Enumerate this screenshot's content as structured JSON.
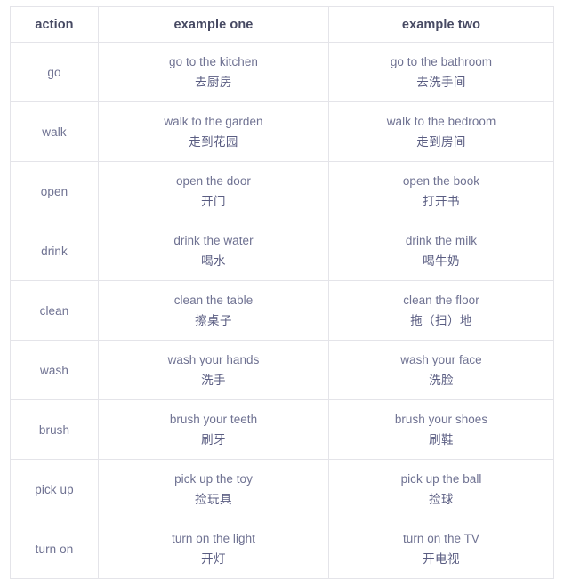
{
  "table": {
    "columns": [
      {
        "key": "action",
        "label": "action"
      },
      {
        "key": "example_one",
        "label": "example one"
      },
      {
        "key": "example_two",
        "label": "example two"
      }
    ],
    "rows": [
      {
        "action": "go",
        "example_one_en": "go to the kitchen",
        "example_one_zh": "去厨房",
        "example_two_en": "go to the bathroom",
        "example_two_zh": "去洗手间"
      },
      {
        "action": "walk",
        "example_one_en": "walk to the garden",
        "example_one_zh": "走到花园",
        "example_two_en": "walk to the bedroom",
        "example_two_zh": "走到房间"
      },
      {
        "action": "open",
        "example_one_en": "open the door",
        "example_one_zh": "开门",
        "example_two_en": "open the book",
        "example_two_zh": "打开书"
      },
      {
        "action": "drink",
        "example_one_en": "drink the water",
        "example_one_zh": "喝水",
        "example_two_en": "drink the milk",
        "example_two_zh": "喝牛奶"
      },
      {
        "action": "clean",
        "example_one_en": "clean the table",
        "example_one_zh": "擦桌子",
        "example_two_en": "clean the floor",
        "example_two_zh": "拖（扫）地"
      },
      {
        "action": "wash",
        "example_one_en": "wash your hands",
        "example_one_zh": "洗手",
        "example_two_en": "wash your face",
        "example_two_zh": "洗脸"
      },
      {
        "action": "brush",
        "example_one_en": "brush your teeth",
        "example_one_zh": "刷牙",
        "example_two_en": "brush your shoes",
        "example_two_zh": "刷鞋"
      },
      {
        "action": "pick up",
        "example_one_en": "pick up the toy",
        "example_one_zh": "捡玩具",
        "example_two_en": "pick up the ball",
        "example_two_zh": "捡球"
      },
      {
        "action": "turn on",
        "example_one_en": "turn on the light",
        "example_one_zh": "开灯",
        "example_two_en": "turn on the TV",
        "example_two_zh": "开电视"
      }
    ]
  },
  "colors": {
    "border": "#e4e4e9",
    "header_text": "#474a63",
    "body_text": "#6f7292",
    "chinese_text": "#5a5d82",
    "background": "#ffffff"
  }
}
